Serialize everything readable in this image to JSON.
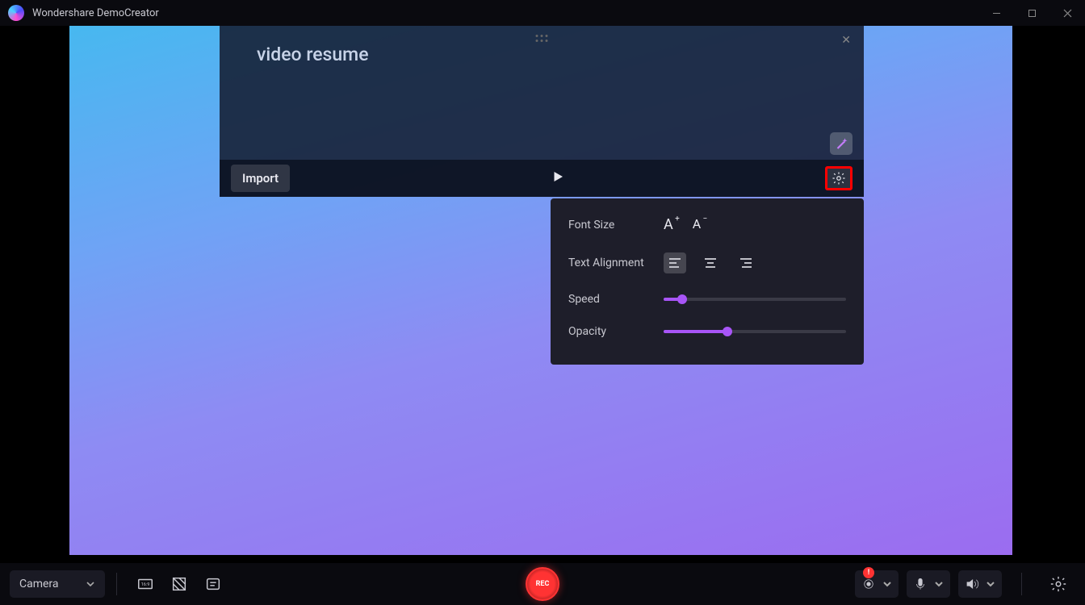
{
  "app": {
    "title": "Wondershare DemoCreator"
  },
  "teleprompter": {
    "text": "video resume",
    "import_label": "Import"
  },
  "settings": {
    "font_size_label": "Font Size",
    "alignment_label": "Text Alignment",
    "speed_label": "Speed",
    "opacity_label": "Opacity",
    "speed_value": 10,
    "opacity_value": 35
  },
  "bottombar": {
    "source_label": "Camera",
    "rec_label": "REC",
    "alert": "!"
  }
}
